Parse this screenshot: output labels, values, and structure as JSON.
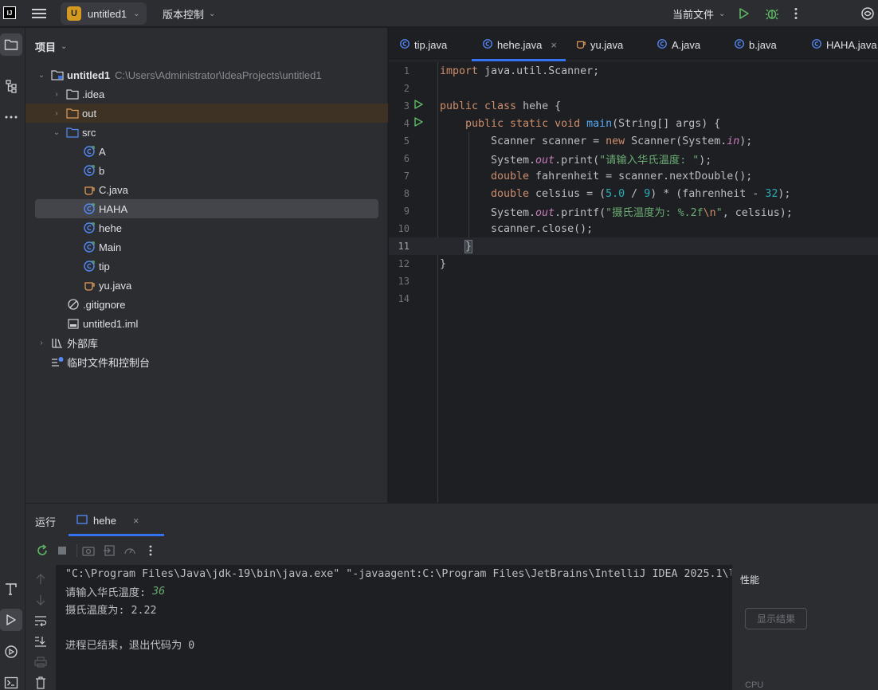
{
  "titlebar": {
    "project_badge": "U",
    "project_name": "untitled1",
    "vcs_menu": "版本控制",
    "run_config": "当前文件"
  },
  "project_panel": {
    "title": "项目",
    "tree": [
      {
        "label": "untitled1",
        "path": "C:\\Users\\Administrator\\IdeaProjects\\untitled1"
      },
      {
        "label": ".idea"
      },
      {
        "label": "out"
      },
      {
        "label": "src"
      },
      {
        "label": "A"
      },
      {
        "label": "b"
      },
      {
        "label": "C.java"
      },
      {
        "label": "HAHA"
      },
      {
        "label": "hehe"
      },
      {
        "label": "Main"
      },
      {
        "label": "tip"
      },
      {
        "label": "yu.java"
      },
      {
        "label": ".gitignore"
      },
      {
        "label": "untitled1.iml"
      },
      {
        "label": "外部库"
      },
      {
        "label": "临时文件和控制台"
      }
    ]
  },
  "editor": {
    "tabs": [
      "tip.java",
      "hehe.java",
      "yu.java",
      "A.java",
      "b.java",
      "HAHA.java"
    ],
    "active_tab": "hehe.java",
    "line_numbers": [
      "1",
      "2",
      "3",
      "4",
      "5",
      "6",
      "7",
      "8",
      "9",
      "10",
      "11",
      "12",
      "13",
      "14"
    ],
    "code": {
      "l1_kw": "import",
      "l1_rest": " java.util.Scanner;",
      "l3_kw": "public class",
      "l3_rest": " hehe {",
      "l4_kw": "public static void",
      "l4_fn": "main",
      "l4_rest": "(String[] args) {",
      "l5_a": "Scanner scanner = ",
      "l5_kw": "new",
      "l5_b": " Scanner(System.",
      "l5_fld": "in",
      "l5_c": ");",
      "l6_a": "System.",
      "l6_fld": "out",
      "l6_b": ".print(",
      "l6_str": "\"请输入华氏温度: \"",
      "l6_c": ");",
      "l7_kw": "double",
      "l7_rest": " fahrenheit = scanner.nextDouble();",
      "l8_kw": "double",
      "l8_a": " celsius = (",
      "l8_n1": "5.0",
      "l8_b": " / ",
      "l8_n2": "9",
      "l8_c": ") * (fahrenheit - ",
      "l8_n3": "32",
      "l8_d": ");",
      "l9_a": "System.",
      "l9_fld": "out",
      "l9_b": ".printf(",
      "l9_str": "\"摄氏温度为: %.2f",
      "l9_esc": "\\n",
      "l9_str2": "\"",
      "l9_c": ", celsius);",
      "l10": "scanner.close();",
      "l11": "}",
      "l12": "}"
    }
  },
  "run_panel": {
    "title": "运行",
    "tab": "hehe",
    "console": {
      "cmd": "\"C:\\Program Files\\Java\\jdk-19\\bin\\java.exe\" \"-javaagent:C:\\Program Files\\JetBrains\\IntelliJ IDEA 2025.1\\l",
      "prompt": "请输入华氏温度: ",
      "input": "36",
      "result": "摄氏温度为: 2.22",
      "exit": "进程已结束，退出代码为 0"
    },
    "perf_title": "性能",
    "perf_button": "显示结果",
    "perf_cpu": "CPU"
  },
  "colors": {
    "accent": "#3574f0",
    "run_green": "#5fb865",
    "badge": "#d49a20"
  }
}
